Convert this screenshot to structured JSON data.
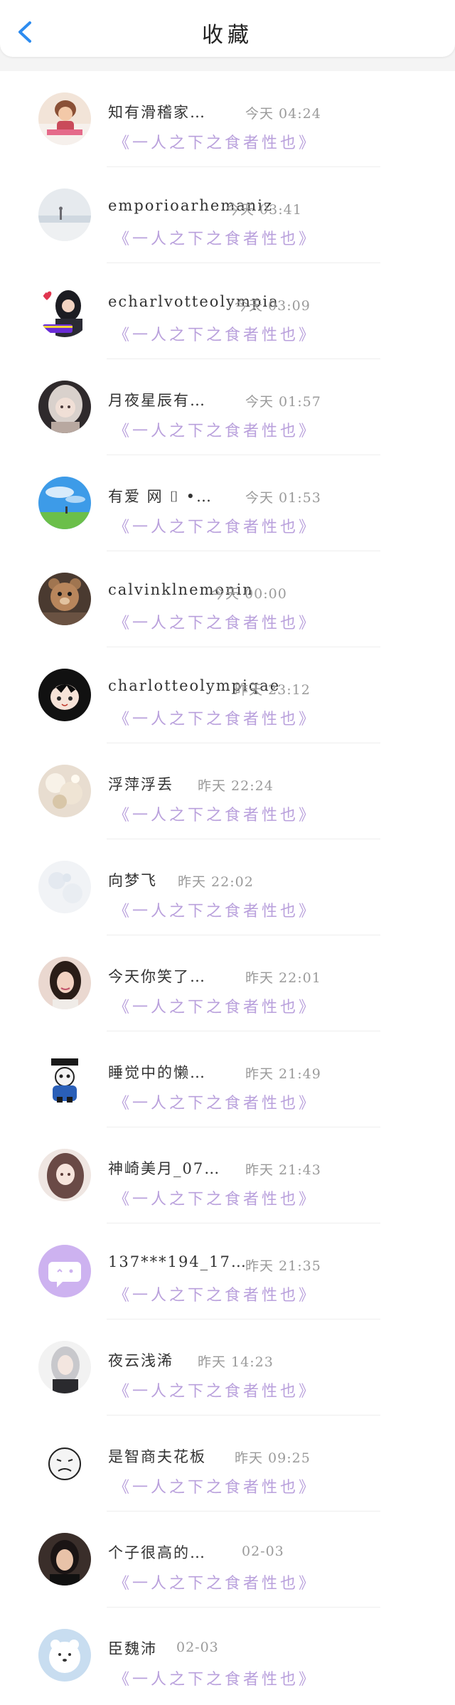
{
  "header": {
    "title": "收藏"
  },
  "items": [
    {
      "name": "知有滑稽家…",
      "time": "今天 04:24",
      "work": "《一人之下之食者性也》",
      "avatar_icon": "girl-photo-avatar"
    },
    {
      "name": "emporioarhemaniz",
      "time": "今天 03:41",
      "work": "《一人之下之食者性也》",
      "avatar_icon": "seaside-photo-avatar"
    },
    {
      "name": "echarlvotteolympia",
      "time": "今天 03:09",
      "work": "《一人之下之食者性也》",
      "avatar_icon": "girl-heart-avatar"
    },
    {
      "name": "月夜星辰有…",
      "time": "今天 01:57",
      "work": "《一人之下之食者性也》",
      "avatar_icon": "anime-girl-avatar"
    },
    {
      "name": "有爱 网 ⌷ •…",
      "time": "今天 01:53",
      "work": "《一人之下之食者性也》",
      "avatar_icon": "sky-landscape-avatar"
    },
    {
      "name": "calvinklnemonin",
      "time": "今天 00:00",
      "work": "《一人之下之食者性也》",
      "avatar_icon": "bear-toy-avatar"
    },
    {
      "name": "charlotteolympiqae",
      "time": "昨天 23:12",
      "work": "《一人之下之食者性也》",
      "avatar_icon": "anime-boy-avatar"
    },
    {
      "name": "浮萍浮丢",
      "time": "昨天 22:24",
      "work": "《一人之下之食者性也》",
      "avatar_icon": "flower-photo-avatar"
    },
    {
      "name": "向梦飞",
      "time": "昨天 22:02",
      "work": "《一人之下之食者性也》",
      "avatar_icon": "pale-floral-avatar"
    },
    {
      "name": "今天你笑了…",
      "time": "昨天 22:01",
      "work": "《一人之下之食者性也》",
      "avatar_icon": "woman-photo-avatar"
    },
    {
      "name": "睡觉中的懒…",
      "time": "昨天 21:49",
      "work": "《一人之下之食者性也》",
      "avatar_icon": "sans-sleep-avatar"
    },
    {
      "name": "神崎美月_07…",
      "time": "昨天 21:43",
      "work": "《一人之下之食者性也》",
      "avatar_icon": "anime-longhair-avatar"
    },
    {
      "name": "137***194_17…",
      "time": "昨天 21:35",
      "work": "《一人之下之食者性也》",
      "avatar_icon": "default-chat-avatar"
    },
    {
      "name": "夜云浅浠",
      "time": "昨天 14:23",
      "work": "《一人之下之食者性也》",
      "avatar_icon": "silver-hair-avatar"
    },
    {
      "name": "是智商夫花板",
      "time": "昨天 09:25",
      "work": "《一人之下之食者性也》",
      "avatar_icon": "meme-face-avatar"
    },
    {
      "name": "个子很高的…",
      "time": "02-03",
      "work": "《一人之下之食者性也》",
      "avatar_icon": "woman-selfie-avatar"
    },
    {
      "name": "臣魏沛",
      "time": "02-03",
      "work": "《一人之下之食者性也》",
      "avatar_icon": "polar-bear-avatar"
    }
  ],
  "colors": {
    "accent": "#2d8cf0",
    "work_text": "#b9a0dc",
    "default_avatar": "#cdb2f0"
  }
}
